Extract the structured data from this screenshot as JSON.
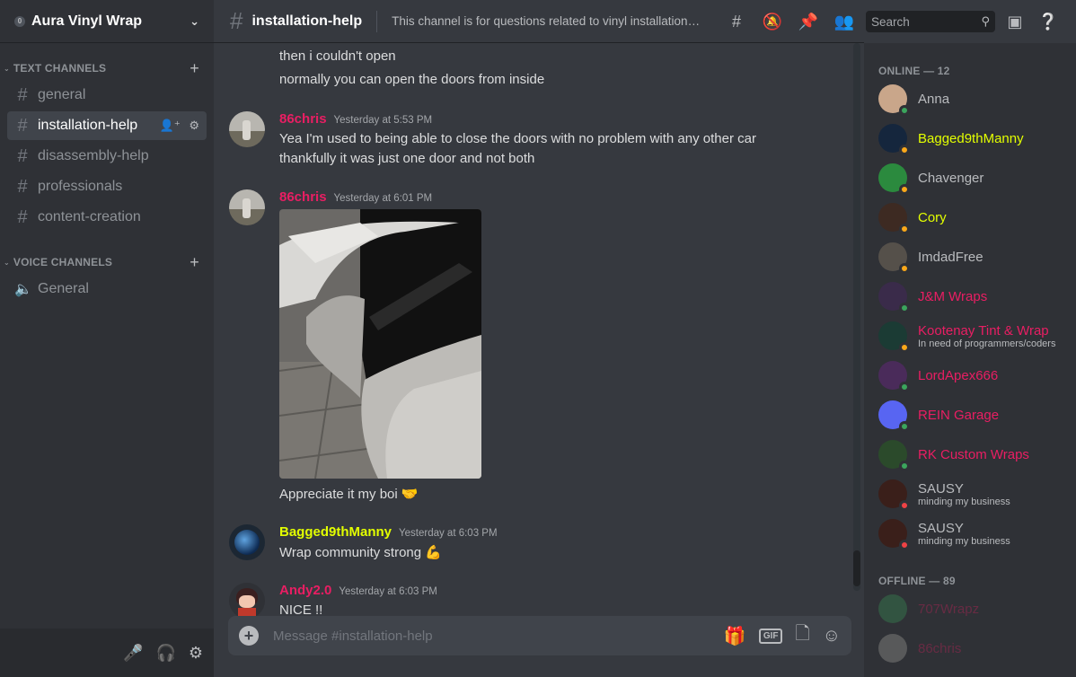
{
  "server": {
    "badge": "0",
    "name": "Aura Vinyl Wrap"
  },
  "sidebar": {
    "text_category": "TEXT CHANNELS",
    "voice_category": "VOICE CHANNELS",
    "text_channels": [
      "general",
      "installation-help",
      "disassembly-help",
      "professionals",
      "content-creation"
    ],
    "voice_channels": [
      "General"
    ]
  },
  "channel": {
    "name": "installation-help",
    "topic": "This channel is for questions related to vinyl installation. ..."
  },
  "search": {
    "placeholder": "Search"
  },
  "messages": {
    "m0_line1": "then i couldn't open",
    "m0_line2": "normally you can open the doors from inside",
    "m1_user": "86chris",
    "m1_time": "Yesterday at 5:53 PM",
    "m1_line1": "Yea I'm used to being able to close the doors with no problem with any other car",
    "m1_line2": "thankfully it was just one door and not both",
    "m2_user": "86chris",
    "m2_time": "Yesterday at 6:01 PM",
    "m2_line1": "Appreciate it my boi 🤝",
    "m3_user": "Bagged9thManny",
    "m3_time": "Yesterday at 6:03 PM",
    "m3_line1": "Wrap community strong 💪",
    "m4_user": "Andy2.0",
    "m4_time": "Yesterday at 6:03 PM",
    "m4_line1": "NICE !!"
  },
  "composer": {
    "placeholder": "Message #installation-help",
    "gif": "GIF"
  },
  "members": {
    "online_header": "ONLINE — 12",
    "offline_header": "OFFLINE — 89",
    "online": [
      {
        "name": "Anna",
        "color": "#b9bbbe",
        "sub": ""
      },
      {
        "name": "Bagged9thManny",
        "color": "#e3ff00",
        "sub": ""
      },
      {
        "name": "Chavenger",
        "color": "#b9bbbe",
        "sub": ""
      },
      {
        "name": "Cory",
        "color": "#e3ff00",
        "sub": ""
      },
      {
        "name": "ImdadFree",
        "color": "#b9bbbe",
        "sub": ""
      },
      {
        "name": "J&M Wraps",
        "color": "#e91e63",
        "sub": ""
      },
      {
        "name": "Kootenay Tint & Wrap",
        "color": "#e91e63",
        "sub": "In need of programmers/coders"
      },
      {
        "name": "LordApex666",
        "color": "#e91e63",
        "sub": ""
      },
      {
        "name": "REIN Garage",
        "color": "#e91e63",
        "sub": ""
      },
      {
        "name": "RK Custom Wraps",
        "color": "#e91e63",
        "sub": ""
      },
      {
        "name": "SAUSY",
        "color": "#b9bbbe",
        "sub": "minding my business"
      },
      {
        "name": "SAUSY",
        "color": "#b9bbbe",
        "sub": "minding my business"
      }
    ],
    "offline": [
      {
        "name": "707Wrapz",
        "color": "#e91e63"
      },
      {
        "name": "86chris",
        "color": "#e91e63"
      }
    ]
  },
  "colors": {
    "pink_user": "#e91e63",
    "yellow_user": "#e3ff00",
    "online": "#3ba55d",
    "idle": "#faa81a",
    "dnd": "#ed4245"
  }
}
